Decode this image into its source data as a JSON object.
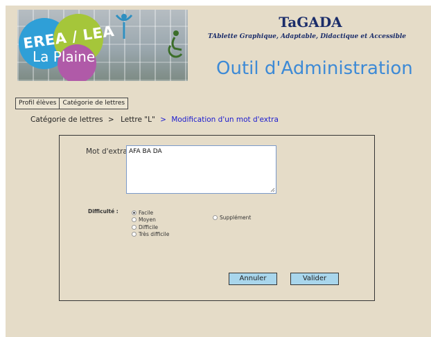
{
  "logo": {
    "line1": "EREA / LEA",
    "line2": "La Plaine"
  },
  "header": {
    "app_title": "TaGADA",
    "app_subtitle": "TAblette Graphique, Adaptable, Didactique et Accessible",
    "section_title": "Outil d'Administration"
  },
  "tabs": [
    {
      "label": "Profil élèves"
    },
    {
      "label": "Catégorie de lettres"
    }
  ],
  "breadcrumb": {
    "item1": "Catégorie de lettres",
    "sep1": ">",
    "item2": "Lettre \"L\"",
    "sep2": ">",
    "current": "Modification d'un mot d'extra"
  },
  "form": {
    "mot_label": "Mot d'extra",
    "mot_value": "AFA BA DA",
    "difficulty_label": "Difficulté :",
    "difficulty_options": [
      {
        "label": "Facile",
        "checked": true
      },
      {
        "label": "Moyen",
        "checked": false
      },
      {
        "label": "Difficile",
        "checked": false
      },
      {
        "label": "Très difficile",
        "checked": false
      }
    ],
    "supplement_label": "Supplément",
    "cancel_label": "Annuler",
    "submit_label": "Valider"
  },
  "colors": {
    "background": "#e5dcc8",
    "title": "#1b2d6a",
    "section_title": "#3d8ad6",
    "button": "#a9d6ec",
    "breadcrumb_current": "#1a1ad0"
  }
}
